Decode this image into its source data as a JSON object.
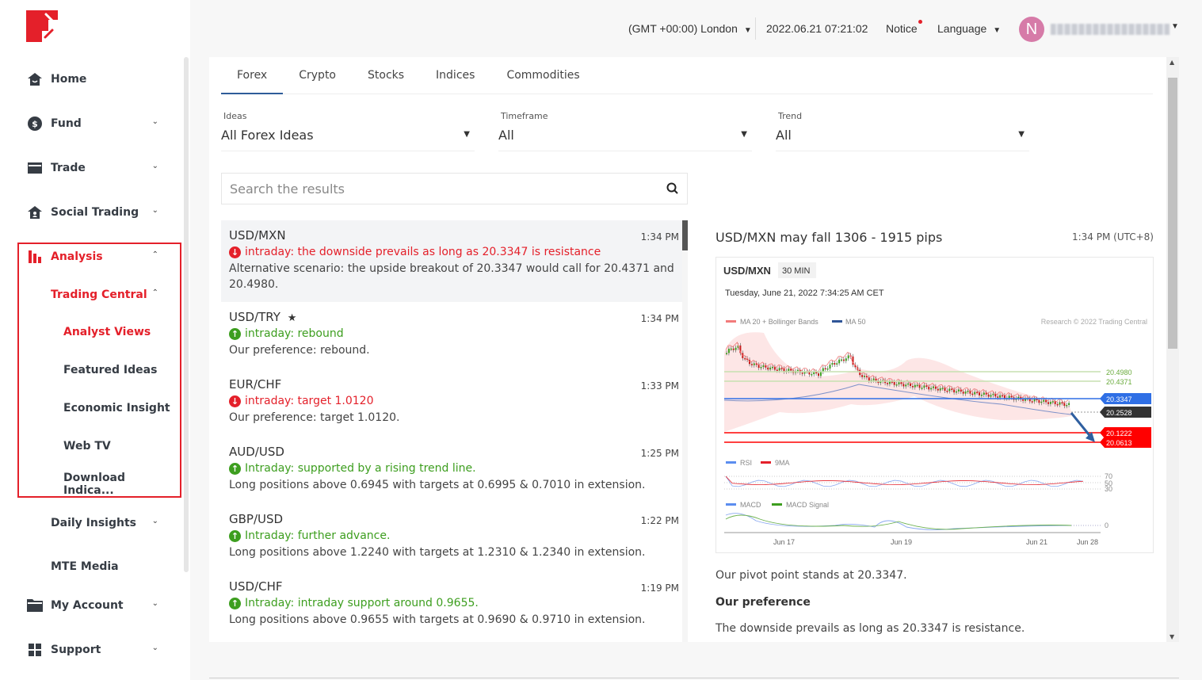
{
  "sidebar": {
    "items": [
      {
        "label": "Home",
        "icon": "home-icon"
      },
      {
        "label": "Fund",
        "icon": "dollar-icon"
      },
      {
        "label": "Trade",
        "icon": "card-icon"
      },
      {
        "label": "Social Trading",
        "icon": "social-icon"
      },
      {
        "label": "Analysis",
        "icon": "bar-chart-icon"
      },
      {
        "label": "Trading Central"
      },
      {
        "label": "Analyst Views"
      },
      {
        "label": "Featured Ideas"
      },
      {
        "label": "Economic Insight"
      },
      {
        "label": "Web TV"
      },
      {
        "label": "Download Indica..."
      },
      {
        "label": "Daily Insights"
      },
      {
        "label": "MTE Media"
      },
      {
        "label": "My Account",
        "icon": "folder-icon"
      },
      {
        "label": "Support",
        "icon": "grid-icon"
      }
    ],
    "accent": "#e4202a"
  },
  "topbar": {
    "timezone": "(GMT +00:00) London",
    "datetime": "2022.06.21 07:21:02",
    "notice": "Notice",
    "language": "Language",
    "avatar_initial": "N"
  },
  "tabs": [
    "Forex",
    "Crypto",
    "Stocks",
    "Indices",
    "Commodities"
  ],
  "filters": {
    "ideas": {
      "label": "Ideas",
      "value": "All Forex Ideas"
    },
    "timeframe": {
      "label": "Timeframe",
      "value": "All"
    },
    "trend": {
      "label": "Trend",
      "value": "All"
    }
  },
  "search": {
    "placeholder": "Search the results"
  },
  "ideas": [
    {
      "pair": "USD/MXN",
      "time": "1:34 PM",
      "direction": "down",
      "headline": "intraday: the downside prevails as long as 20.3347 is resistance",
      "desc": "Alternative scenario: the upside breakout of 20.3347 would call for 20.4371 and 20.4980."
    },
    {
      "pair": "USD/TRY",
      "time": "1:34 PM",
      "direction": "up",
      "starred": true,
      "headline": "intraday: rebound",
      "desc": "Our preference: rebound."
    },
    {
      "pair": "EUR/CHF",
      "time": "1:33 PM",
      "direction": "down",
      "headline": "intraday: target 1.0120",
      "desc": "Our preference: target 1.0120."
    },
    {
      "pair": "AUD/USD",
      "time": "1:25 PM",
      "direction": "up",
      "headline": "Intraday: supported by a rising trend line.",
      "desc": "Long positions above 0.6945 with targets at 0.6995 & 0.7010 in extension."
    },
    {
      "pair": "GBP/USD",
      "time": "1:22 PM",
      "direction": "up",
      "headline": "Intraday: further advance.",
      "desc": "Long positions above 1.2240 with targets at 1.2310 & 1.2340 in extension."
    },
    {
      "pair": "USD/CHF",
      "time": "1:19 PM",
      "direction": "up",
      "headline": "Intraday: intraday support around 0.9655.",
      "desc": "Long positions above 0.9655 with targets at 0.9690 & 0.9710 in extension."
    }
  ],
  "detail": {
    "title": "USD/MXN may fall 1306 - 1915 pips",
    "time": "1:34 PM (UTC+8)",
    "chart": {
      "symbol": "USD/MXN",
      "interval": "30 MIN",
      "timestamp": "Tuesday, June 21, 2022 7:34:25 AM CET",
      "legend1": "MA 20 + Bollinger Bands",
      "legend2": "MA 50",
      "copyright": "Research © 2022 Trading Central",
      "levels": [
        {
          "value": "20.4980",
          "color": "#6aab3c"
        },
        {
          "value": "20.4371",
          "color": "#6aab3c"
        },
        {
          "value": "20.3347",
          "color": "#2f6fe5"
        },
        {
          "value": "20.2528",
          "color": "#333333"
        },
        {
          "value": "20.1222",
          "color": "#ff0000"
        },
        {
          "value": "20.0613",
          "color": "#ff0000"
        }
      ],
      "rsi_legend": [
        "RSI",
        "9MA"
      ],
      "rsi_ticks": [
        "70",
        "50",
        "30"
      ],
      "macd_legend": [
        "MACD",
        "MACD Signal"
      ],
      "macd_tick": "0",
      "x_ticks": [
        "Jun 17",
        "Jun 19",
        "Jun 21",
        "Jun 28"
      ]
    },
    "pivot": "Our pivot point stands at 20.3347.",
    "pref_heading": "Our preference",
    "pref_text": "The downside prevails as long as 20.3347 is resistance."
  }
}
